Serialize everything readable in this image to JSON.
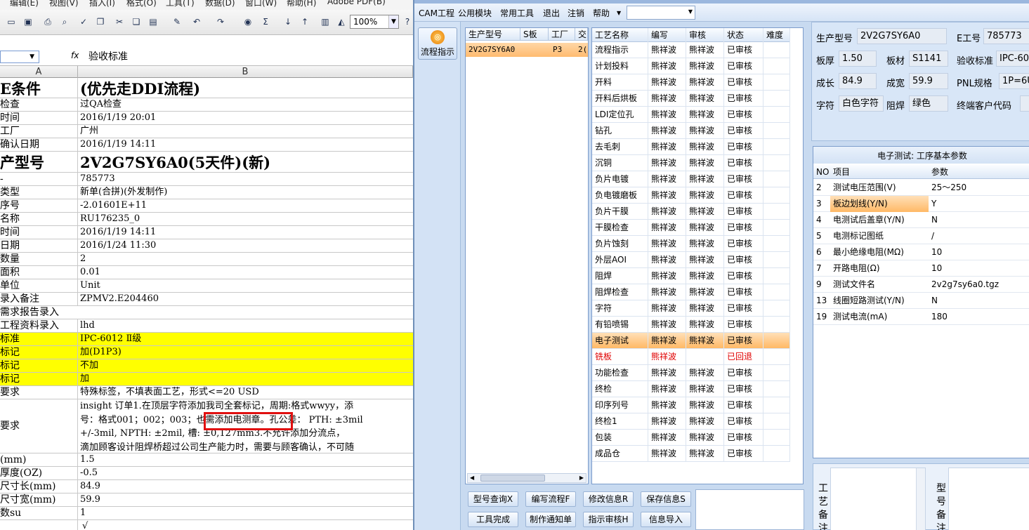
{
  "excel": {
    "menu": [
      "编辑(E)",
      "视图(V)",
      "插入(I)",
      "格式(O)",
      "工具(T)",
      "数据(D)",
      "窗口(W)",
      "帮助(H)",
      "Adobe PDF(B)"
    ],
    "zoom": "100%",
    "name_box": "",
    "formula_content": "验收标准",
    "columns": [
      "A",
      "B"
    ],
    "rows": [
      {
        "a": "E条件",
        "b": "(优先走DDI流程)"
      },
      {
        "a": "检查",
        "b": "过QA检查"
      },
      {
        "a": "时间",
        "b": "2016/1/19 20:01"
      },
      {
        "a": "工厂",
        "b": "广州"
      },
      {
        "a": "确认日期",
        "b": "2016/1/19 14:11"
      },
      {
        "a": "产型号",
        "b": "2V2G7SY6A0(5天件)(新)"
      },
      {
        "a": "-",
        "b": "785773"
      },
      {
        "a": "类型",
        "b": "新单(合拼)(外发制作)"
      },
      {
        "a": "序号",
        "b": "-2.01601E+11"
      },
      {
        "a": "名称",
        "b": "RU176235_0"
      },
      {
        "a": "时间",
        "b": "2016/1/19 14:11"
      },
      {
        "a": "日期",
        "b": "2016/1/24 11:30"
      },
      {
        "a": "数量",
        "b": "2"
      },
      {
        "a": "面积",
        "b": "0.01"
      },
      {
        "a": "单位",
        "b": "Unit"
      },
      {
        "a": "录入备注",
        "b": "ZPMV2.E204460"
      },
      {
        "a": "需求报告录入",
        "b": ""
      },
      {
        "a": "工程资料录入",
        "b": "lhd"
      },
      {
        "a": "标准",
        "b": "IPC-6012 Ⅱ级"
      },
      {
        "a": "标记",
        "b": "加(D1P3)"
      },
      {
        "a": "标记",
        "b": "不加"
      },
      {
        "a": "标记",
        "b": "加"
      },
      {
        "a": "要求",
        "b": "特殊标签，不填表面工艺，形式<=20 USD"
      },
      {
        "a": "要求",
        "b_lines": [
          "insight 订单1.在顶层字符添加我司全套标记，周期:格式wwyy，添",
          "号：格式001；002；003；也需添加电测章。孔公差： PTH: ±3mil",
          "+/-3mil,  NPTH: ±2mil,    槽: ±0,127mm3.不允许添加分流点，",
          "滴加顾客设计阻焊桥超过公司生产能力时，需要与顾客确认，不可随"
        ]
      },
      {
        "a": "(mm)",
        "b": "1.5"
      },
      {
        "a": "厚度(OZ)",
        "b": "-0.5"
      },
      {
        "a": "尺寸长(mm)",
        "b": "84.9"
      },
      {
        "a": "尺寸宽(mm)",
        "b": "59.9"
      },
      {
        "a": "数su",
        "b": "1"
      },
      {
        "a": "",
        "b": "√"
      }
    ]
  },
  "cam": {
    "menu": [
      "CAM工程",
      "公用模块",
      "常用工具",
      "退出",
      "注销",
      "帮助"
    ],
    "flow_button": "流程指示",
    "product_list": {
      "headers": [
        "生产型号",
        "S板",
        "工厂",
        "交"
      ],
      "rows": [
        [
          "2V2G7SY6A0",
          "",
          "P3",
          "2("
        ]
      ]
    },
    "process": {
      "headers": [
        "工艺名称",
        "编写",
        "审核",
        "状态",
        "难度"
      ],
      "rows": [
        [
          "流程指示",
          "熊祥波",
          "熊祥波",
          "已审核"
        ],
        [
          "计划投料",
          "熊祥波",
          "熊祥波",
          "已审核"
        ],
        [
          "开料",
          "熊祥波",
          "熊祥波",
          "已审核"
        ],
        [
          "开料后烘板",
          "熊祥波",
          "熊祥波",
          "已审核"
        ],
        [
          "LDI定位孔",
          "熊祥波",
          "熊祥波",
          "已审核"
        ],
        [
          "钻孔",
          "熊祥波",
          "熊祥波",
          "已审核"
        ],
        [
          "去毛刺",
          "熊祥波",
          "熊祥波",
          "已审核"
        ],
        [
          "沉铜",
          "熊祥波",
          "熊祥波",
          "已审核"
        ],
        [
          "负片电镀",
          "熊祥波",
          "熊祥波",
          "已审核"
        ],
        [
          "负电镀磨板",
          "熊祥波",
          "熊祥波",
          "已审核"
        ],
        [
          "负片干膜",
          "熊祥波",
          "熊祥波",
          "已审核"
        ],
        [
          "干膜检查",
          "熊祥波",
          "熊祥波",
          "已审核"
        ],
        [
          "负片蚀刻",
          "熊祥波",
          "熊祥波",
          "已审核"
        ],
        [
          "外层AOI",
          "熊祥波",
          "熊祥波",
          "已审核"
        ],
        [
          "阻焊",
          "熊祥波",
          "熊祥波",
          "已审核"
        ],
        [
          "阻焊检查",
          "熊祥波",
          "熊祥波",
          "已审核"
        ],
        [
          "字符",
          "熊祥波",
          "熊祥波",
          "已审核"
        ],
        [
          "有铅喷锡",
          "熊祥波",
          "熊祥波",
          "已审核"
        ],
        [
          "电子测试",
          "熊祥波",
          "熊祥波",
          "已审核"
        ],
        [
          "铣板",
          "熊祥波",
          "",
          "已回退"
        ],
        [
          "功能检查",
          "熊祥波",
          "熊祥波",
          "已审核"
        ],
        [
          "终检",
          "熊祥波",
          "熊祥波",
          "已审核"
        ],
        [
          "印序列号",
          "熊祥波",
          "熊祥波",
          "已审核"
        ],
        [
          "终检1",
          "熊祥波",
          "熊祥波",
          "已审核"
        ],
        [
          "包装",
          "熊祥波",
          "熊祥波",
          "已审核"
        ],
        [
          "成品仓",
          "熊祥波",
          "熊祥波",
          "已审核"
        ]
      ]
    },
    "buttons": [
      "型号查询X",
      "编写流程F",
      "修改信息R",
      "保存信息S",
      "工具完成",
      "制作通知单",
      "指示审核H",
      "信息导入"
    ],
    "info": {
      "product_label": "生产型号",
      "product_value": "2V2G7SY6A0",
      "eno_label": "E工号",
      "eno_value": "785773",
      "thick_label": "板厚",
      "thick_value": "1.50",
      "mat_label": "板材",
      "mat_value": "S1141",
      "accept_label": "验收标准",
      "accept_value": "IPC-60",
      "len_label": "成长",
      "len_value": "84.9",
      "wid_label": "成宽",
      "wid_value": "59.9",
      "pnl_label": "PNL规格",
      "pnl_value": "1P=6U",
      "char_label": "字符",
      "char_value": "白色字符",
      "mask_label": "阻焊",
      "mask_value": "绿色",
      "cust_label": "终端客户代码",
      "cust_value": ""
    },
    "etest": {
      "title": "电子测试: 工序基本参数",
      "headers": [
        "NO",
        "项目",
        "参数"
      ],
      "rows": [
        [
          "2",
          "测试电压范围(V)",
          "25～250"
        ],
        [
          "3",
          "板边划线(Y/N)",
          "Y"
        ],
        [
          "4",
          "电测试后盖章(Y/N)",
          "N"
        ],
        [
          "5",
          "电测标记图纸",
          "/"
        ],
        [
          "6",
          "最小绝缘电阻(MΩ)",
          "10"
        ],
        [
          "7",
          "开路电阻(Ω)",
          "10"
        ],
        [
          "9",
          "测试文件名",
          "2v2g7sy6a0.tgz"
        ],
        [
          "13",
          "线圈短路测试(Y/N)",
          "N"
        ],
        [
          "19",
          "测试电流(mA)",
          "180"
        ]
      ]
    },
    "notes": {
      "proc_note": "工艺备注",
      "model_note": "型号备注"
    }
  }
}
